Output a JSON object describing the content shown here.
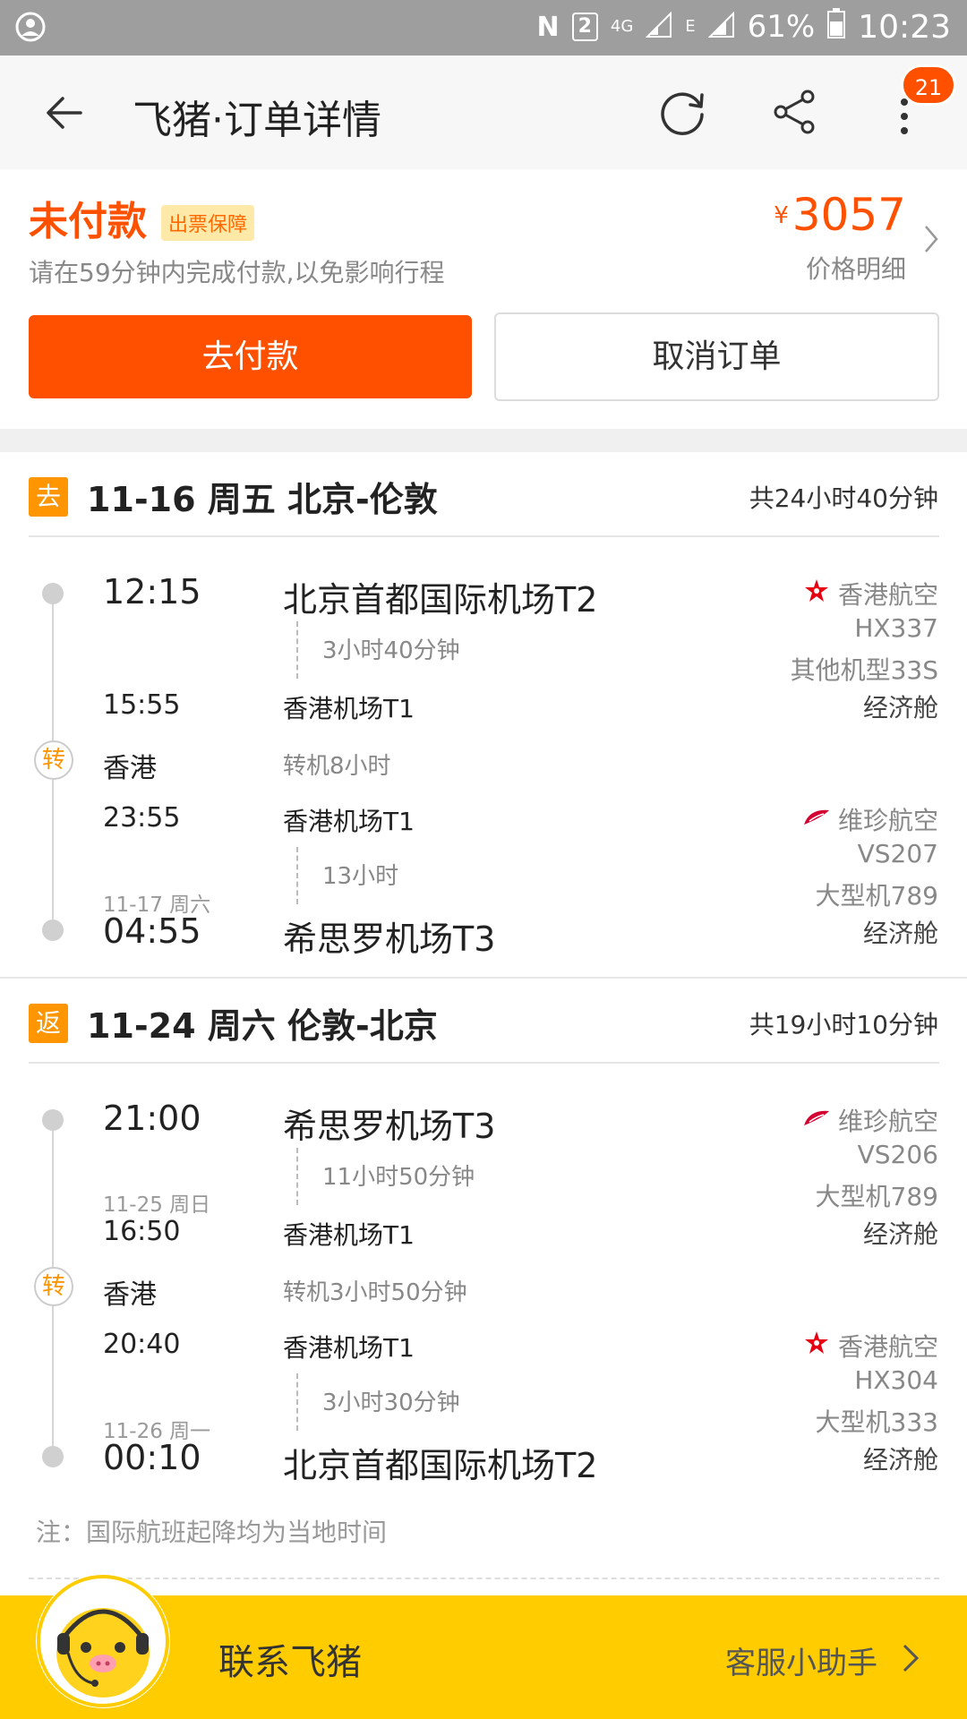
{
  "status_bar": {
    "sim_slot": "2",
    "network": "4G",
    "network2": "E",
    "battery": "61%",
    "time": "10:23"
  },
  "navbar": {
    "title": "飞猪·订单详情",
    "badge_count": "21"
  },
  "order": {
    "status": "未付款",
    "guarantee_tag": "出票保障",
    "pay_hint": "请在59分钟内完成付款,以免影响行程",
    "currency": "¥",
    "price": "3057",
    "price_detail": "价格明细",
    "pay_button": "去付款",
    "cancel_button": "取消订单"
  },
  "outbound": {
    "tag": "去",
    "route": "11-16 周五 北京-伦敦",
    "total_duration": "共24小时40分钟",
    "leg1": {
      "dep_time": "12:15",
      "dep_airport": "北京首都国际机场T2",
      "duration": "3小时40分钟",
      "arr_time": "15:55",
      "arr_airport": "香港机场T1",
      "airline": "香港航空",
      "flight_no": "HX337",
      "aircraft": "其他机型33S",
      "cabin": "经济舱"
    },
    "transfer": {
      "label": "转",
      "city": "香港",
      "note": "转机8小时"
    },
    "leg2": {
      "dep_time": "23:55",
      "dep_airport": "香港机场T1",
      "duration": "13小时",
      "arr_date": "11-17 周六",
      "arr_time": "04:55",
      "arr_airport": "希思罗机场T3",
      "airline": "维珍航空",
      "flight_no": "VS207",
      "aircraft": "大型机789",
      "cabin": "经济舱"
    }
  },
  "return": {
    "tag": "返",
    "route": "11-24 周六 伦敦-北京",
    "total_duration": "共19小时10分钟",
    "leg1": {
      "dep_time": "21:00",
      "dep_airport": "希思罗机场T3",
      "duration": "11小时50分钟",
      "arr_date": "11-25 周日",
      "arr_time": "16:50",
      "arr_airport": "香港机场T1",
      "airline": "维珍航空",
      "flight_no": "VS206",
      "aircraft": "大型机789",
      "cabin": "经济舱"
    },
    "transfer": {
      "label": "转",
      "city": "香港",
      "note": "转机3小时50分钟"
    },
    "leg2": {
      "dep_time": "20:40",
      "dep_airport": "香港机场T1",
      "duration": "3小时30分钟",
      "arr_date": "11-26 周一",
      "arr_time": "00:10",
      "arr_airport": "北京首都国际机场T2",
      "airline": "香港航空",
      "flight_no": "HX304",
      "aircraft": "大型机333",
      "cabin": "经济舱"
    }
  },
  "note": "注：国际航班起降均为当地时间",
  "footer": {
    "title": "联系飞猪",
    "helper": "客服小助手"
  },
  "colors": {
    "accent": "#ff5000",
    "tag": "#ff9500",
    "footer": "#ffcc00",
    "hk_airlines": "#e60012",
    "virgin": "#d50032"
  }
}
